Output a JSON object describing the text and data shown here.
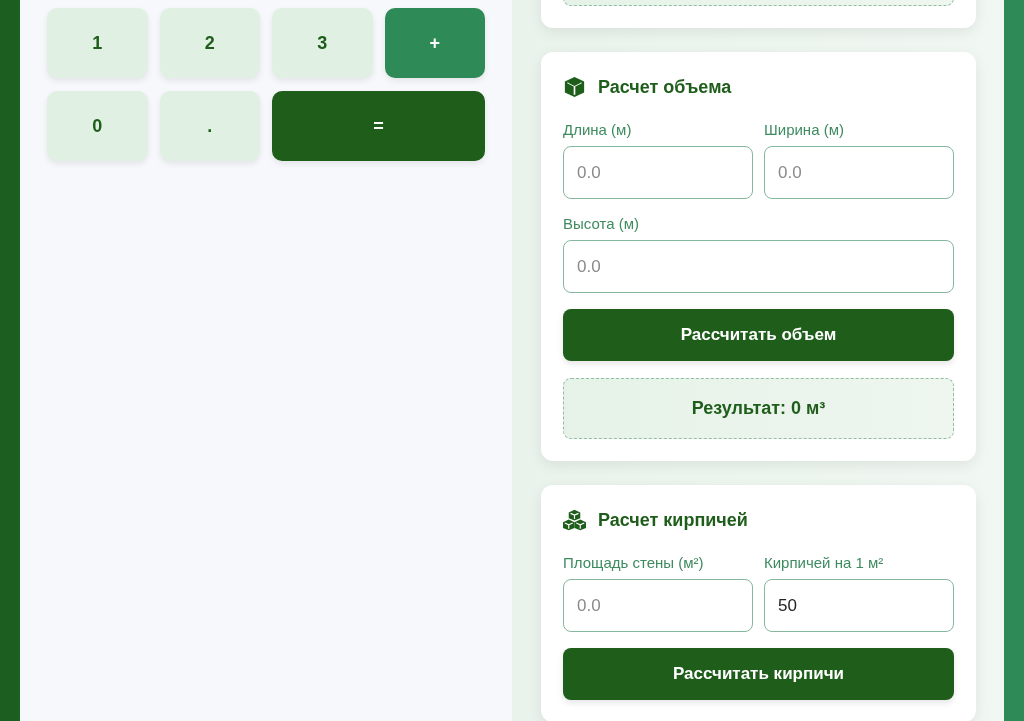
{
  "keypad": {
    "keys": [
      {
        "label": "1",
        "kind": "digit"
      },
      {
        "label": "2",
        "kind": "digit"
      },
      {
        "label": "3",
        "kind": "digit"
      },
      {
        "label": "+",
        "kind": "operator"
      },
      {
        "label": "0",
        "kind": "digit"
      },
      {
        "label": ".",
        "kind": "digit"
      },
      {
        "label": "=",
        "kind": "equals"
      }
    ]
  },
  "cards": [
    {
      "title": "Расчет объема",
      "field_rows": [
        [
          {
            "label": "Длина (м)",
            "placeholder": "0.0"
          },
          {
            "label": "Ширина (м)",
            "placeholder": "0.0"
          }
        ],
        [
          {
            "label": "Высота (м)",
            "placeholder": "0.0"
          }
        ]
      ],
      "button": "Рассчитать объем",
      "result": "Результат: 0 м³"
    },
    {
      "title": "Расчет кирпичей",
      "field_rows": [
        [
          {
            "label": "Площадь стены (м²)",
            "placeholder": "0.0"
          },
          {
            "label": "Кирпичей на 1 м²",
            "value": "50"
          }
        ]
      ],
      "button": "Рассчитать кирпичи"
    }
  ]
}
